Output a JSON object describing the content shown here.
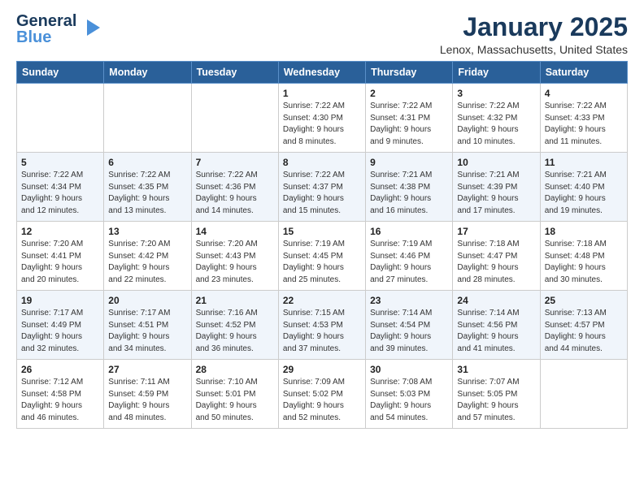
{
  "logo": {
    "line1": "General",
    "line2": "Blue",
    "icon": "▶"
  },
  "header": {
    "title": "January 2025",
    "subtitle": "Lenox, Massachusetts, United States"
  },
  "weekdays": [
    "Sunday",
    "Monday",
    "Tuesday",
    "Wednesday",
    "Thursday",
    "Friday",
    "Saturday"
  ],
  "weeks": [
    [
      {
        "day": "",
        "details": ""
      },
      {
        "day": "",
        "details": ""
      },
      {
        "day": "",
        "details": ""
      },
      {
        "day": "1",
        "details": "Sunrise: 7:22 AM\nSunset: 4:30 PM\nDaylight: 9 hours\nand 8 minutes."
      },
      {
        "day": "2",
        "details": "Sunrise: 7:22 AM\nSunset: 4:31 PM\nDaylight: 9 hours\nand 9 minutes."
      },
      {
        "day": "3",
        "details": "Sunrise: 7:22 AM\nSunset: 4:32 PM\nDaylight: 9 hours\nand 10 minutes."
      },
      {
        "day": "4",
        "details": "Sunrise: 7:22 AM\nSunset: 4:33 PM\nDaylight: 9 hours\nand 11 minutes."
      }
    ],
    [
      {
        "day": "5",
        "details": "Sunrise: 7:22 AM\nSunset: 4:34 PM\nDaylight: 9 hours\nand 12 minutes."
      },
      {
        "day": "6",
        "details": "Sunrise: 7:22 AM\nSunset: 4:35 PM\nDaylight: 9 hours\nand 13 minutes."
      },
      {
        "day": "7",
        "details": "Sunrise: 7:22 AM\nSunset: 4:36 PM\nDaylight: 9 hours\nand 14 minutes."
      },
      {
        "day": "8",
        "details": "Sunrise: 7:22 AM\nSunset: 4:37 PM\nDaylight: 9 hours\nand 15 minutes."
      },
      {
        "day": "9",
        "details": "Sunrise: 7:21 AM\nSunset: 4:38 PM\nDaylight: 9 hours\nand 16 minutes."
      },
      {
        "day": "10",
        "details": "Sunrise: 7:21 AM\nSunset: 4:39 PM\nDaylight: 9 hours\nand 17 minutes."
      },
      {
        "day": "11",
        "details": "Sunrise: 7:21 AM\nSunset: 4:40 PM\nDaylight: 9 hours\nand 19 minutes."
      }
    ],
    [
      {
        "day": "12",
        "details": "Sunrise: 7:20 AM\nSunset: 4:41 PM\nDaylight: 9 hours\nand 20 minutes."
      },
      {
        "day": "13",
        "details": "Sunrise: 7:20 AM\nSunset: 4:42 PM\nDaylight: 9 hours\nand 22 minutes."
      },
      {
        "day": "14",
        "details": "Sunrise: 7:20 AM\nSunset: 4:43 PM\nDaylight: 9 hours\nand 23 minutes."
      },
      {
        "day": "15",
        "details": "Sunrise: 7:19 AM\nSunset: 4:45 PM\nDaylight: 9 hours\nand 25 minutes."
      },
      {
        "day": "16",
        "details": "Sunrise: 7:19 AM\nSunset: 4:46 PM\nDaylight: 9 hours\nand 27 minutes."
      },
      {
        "day": "17",
        "details": "Sunrise: 7:18 AM\nSunset: 4:47 PM\nDaylight: 9 hours\nand 28 minutes."
      },
      {
        "day": "18",
        "details": "Sunrise: 7:18 AM\nSunset: 4:48 PM\nDaylight: 9 hours\nand 30 minutes."
      }
    ],
    [
      {
        "day": "19",
        "details": "Sunrise: 7:17 AM\nSunset: 4:49 PM\nDaylight: 9 hours\nand 32 minutes."
      },
      {
        "day": "20",
        "details": "Sunrise: 7:17 AM\nSunset: 4:51 PM\nDaylight: 9 hours\nand 34 minutes."
      },
      {
        "day": "21",
        "details": "Sunrise: 7:16 AM\nSunset: 4:52 PM\nDaylight: 9 hours\nand 36 minutes."
      },
      {
        "day": "22",
        "details": "Sunrise: 7:15 AM\nSunset: 4:53 PM\nDaylight: 9 hours\nand 37 minutes."
      },
      {
        "day": "23",
        "details": "Sunrise: 7:14 AM\nSunset: 4:54 PM\nDaylight: 9 hours\nand 39 minutes."
      },
      {
        "day": "24",
        "details": "Sunrise: 7:14 AM\nSunset: 4:56 PM\nDaylight: 9 hours\nand 41 minutes."
      },
      {
        "day": "25",
        "details": "Sunrise: 7:13 AM\nSunset: 4:57 PM\nDaylight: 9 hours\nand 44 minutes."
      }
    ],
    [
      {
        "day": "26",
        "details": "Sunrise: 7:12 AM\nSunset: 4:58 PM\nDaylight: 9 hours\nand 46 minutes."
      },
      {
        "day": "27",
        "details": "Sunrise: 7:11 AM\nSunset: 4:59 PM\nDaylight: 9 hours\nand 48 minutes."
      },
      {
        "day": "28",
        "details": "Sunrise: 7:10 AM\nSunset: 5:01 PM\nDaylight: 9 hours\nand 50 minutes."
      },
      {
        "day": "29",
        "details": "Sunrise: 7:09 AM\nSunset: 5:02 PM\nDaylight: 9 hours\nand 52 minutes."
      },
      {
        "day": "30",
        "details": "Sunrise: 7:08 AM\nSunset: 5:03 PM\nDaylight: 9 hours\nand 54 minutes."
      },
      {
        "day": "31",
        "details": "Sunrise: 7:07 AM\nSunset: 5:05 PM\nDaylight: 9 hours\nand 57 minutes."
      },
      {
        "day": "",
        "details": ""
      }
    ]
  ]
}
